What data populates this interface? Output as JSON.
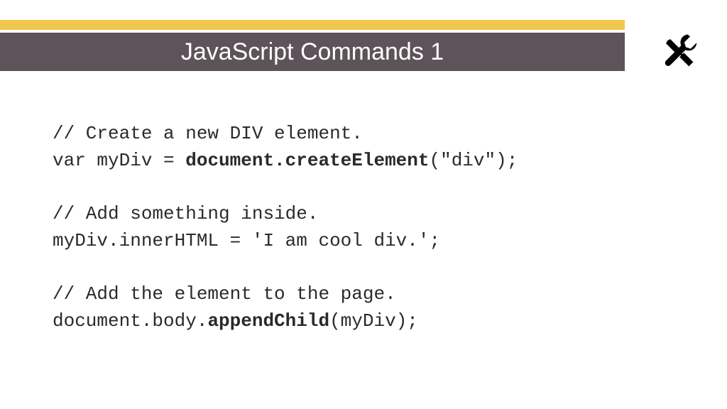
{
  "header": {
    "title": "JavaScript Commands 1"
  },
  "code": {
    "line1": "// Create a new DIV element.",
    "line2a": "var myDiv = ",
    "line2b": "document.createElement",
    "line2c": "(\"div\");",
    "line3": "",
    "line4": "// Add something inside.",
    "line5": "myDiv.innerHTML = 'I am cool div.';",
    "line6": "",
    "line7": "// Add the element to the page.",
    "line8a": "document.body.",
    "line8b": "appendChild",
    "line8c": "(myDiv);"
  }
}
